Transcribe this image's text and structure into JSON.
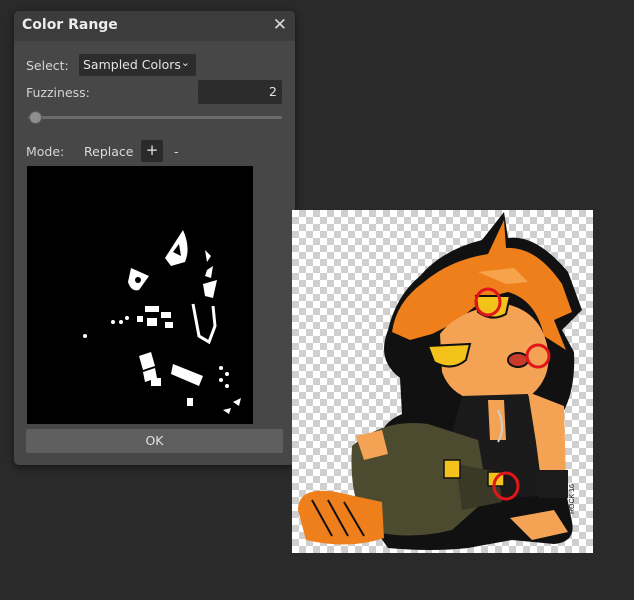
{
  "dialog": {
    "title": "Color Range",
    "close_glyph": "✕",
    "select_label": "Select:",
    "select_value": "Sampled Colors",
    "select_chevron": "⌄",
    "fuzziness_label": "Fuzziness:",
    "fuzziness_value": "2",
    "fuzziness_slider_fraction": 0.01,
    "mode_label": "Mode:",
    "mode_replace": "Replace",
    "mode_add": "+",
    "mode_subtract": "-",
    "ok_label": "OK"
  },
  "artwork": {
    "signature": "ROCK 16",
    "highlight_color": "#e0161b",
    "hair_color": "#ef7f1a",
    "skin_color": "#f4a253"
  }
}
